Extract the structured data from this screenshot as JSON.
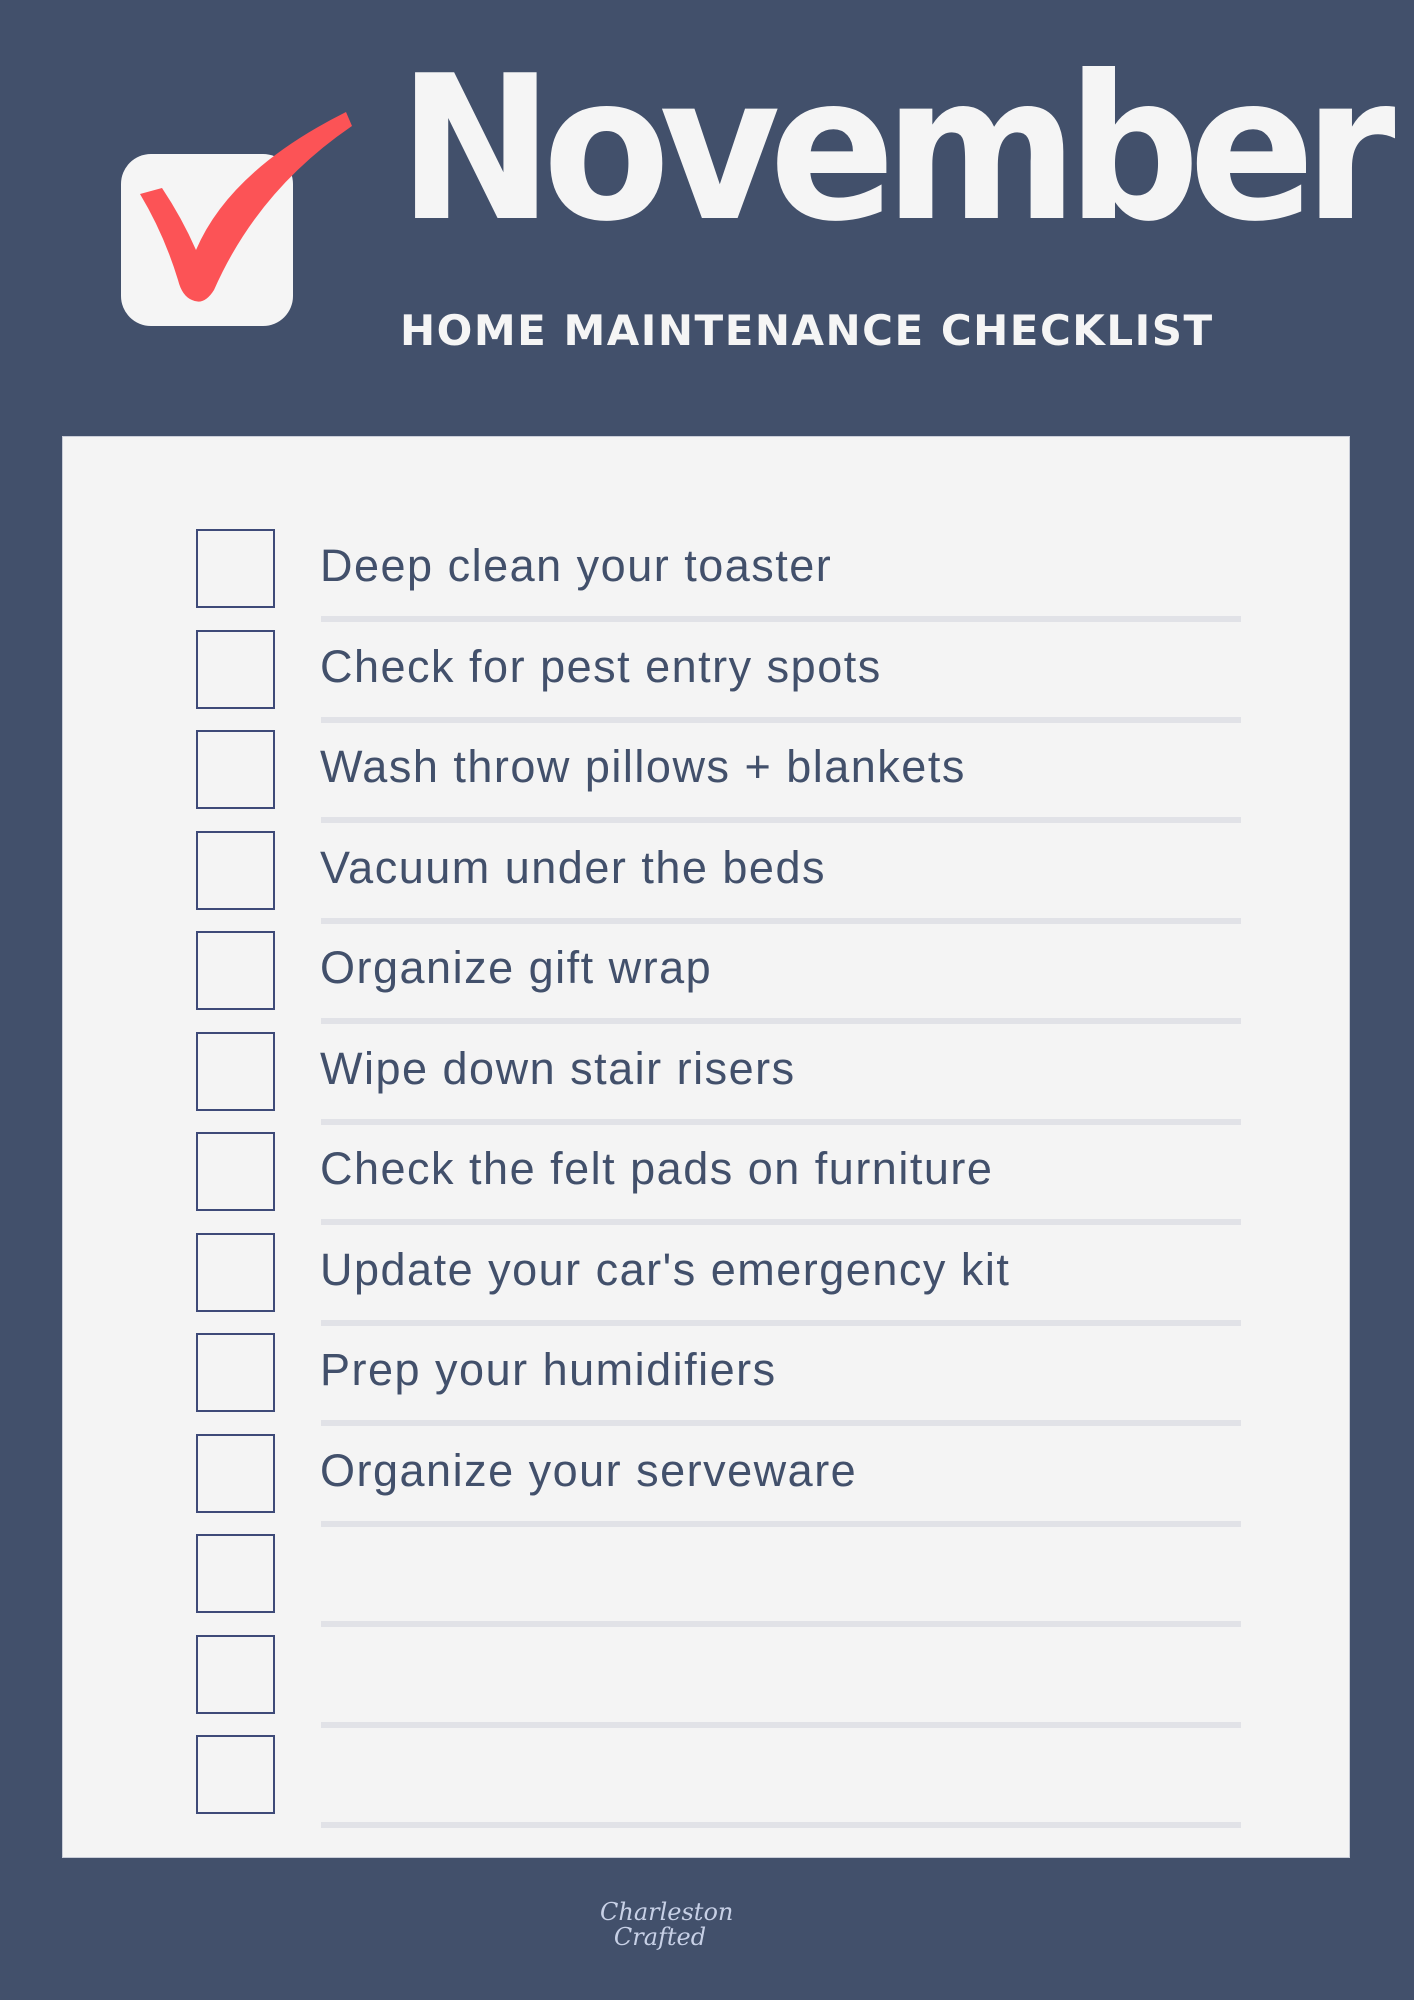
{
  "header": {
    "title": "November",
    "subtitle": "HOME MAINTENANCE CHECKLIST",
    "logo_icon": "checked-box-icon"
  },
  "colors": {
    "background": "#42506b",
    "card": "#f4f4f4",
    "accent_check": "#fc5356",
    "text": "#42506b",
    "checkbox_border": "#3e4a78",
    "divider": "#e1e2e7"
  },
  "checklist": {
    "items": [
      {
        "label": "Deep clean your toaster",
        "checked": false
      },
      {
        "label": "Check for pest entry spots",
        "checked": false
      },
      {
        "label": "Wash throw pillows + blankets",
        "checked": false
      },
      {
        "label": "Vacuum under the beds",
        "checked": false
      },
      {
        "label": "Organize gift wrap",
        "checked": false
      },
      {
        "label": "Wipe down stair risers",
        "checked": false
      },
      {
        "label": "Check the felt pads on furniture",
        "checked": false
      },
      {
        "label": "Update your car's emergency kit",
        "checked": false
      },
      {
        "label": "Prep your humidifiers",
        "checked": false
      },
      {
        "label": "Organize your serveware",
        "checked": false
      },
      {
        "label": "",
        "checked": false
      },
      {
        "label": "",
        "checked": false
      },
      {
        "label": "",
        "checked": false
      }
    ]
  },
  "footer": {
    "brand_line1": "Charleston",
    "brand_line2": "Crafted"
  }
}
